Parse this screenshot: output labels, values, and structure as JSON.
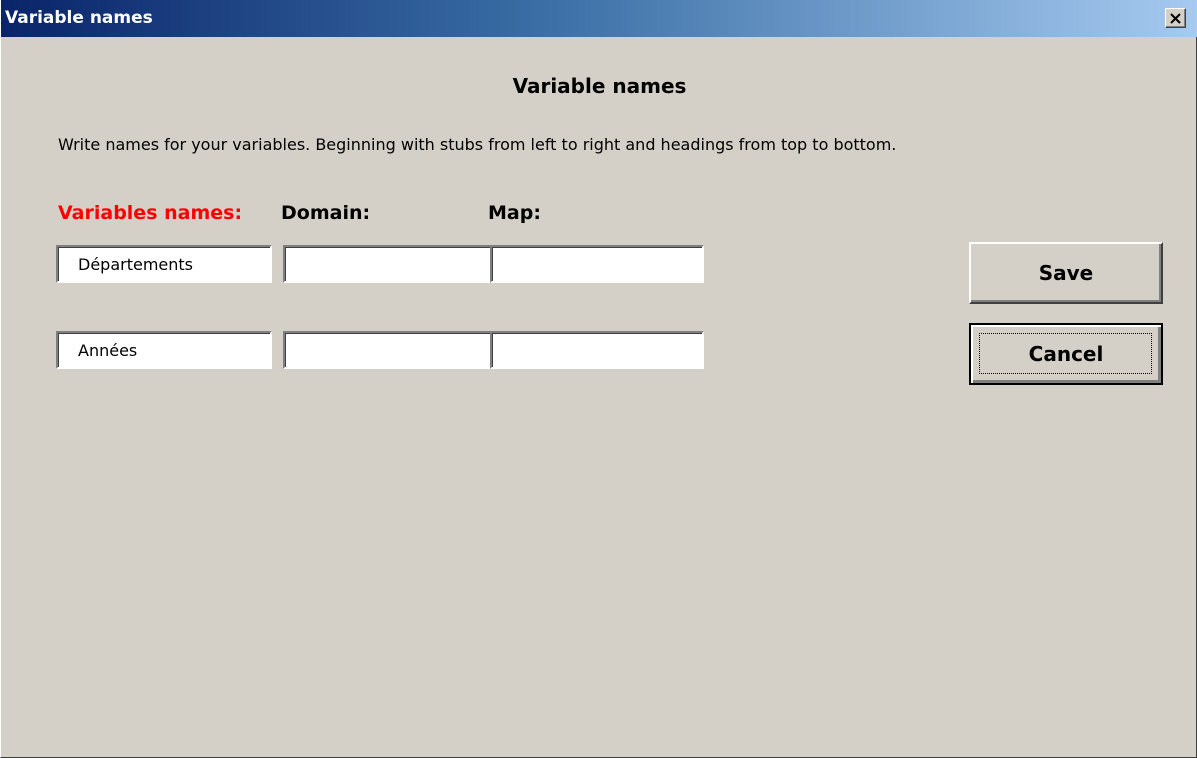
{
  "window": {
    "title": "Variable names",
    "close_icon": "close-icon"
  },
  "dialog": {
    "heading": "Variable names",
    "instructions": "Write names for your variables. Beginning with stubs from left to right and headings from top to bottom."
  },
  "columns": {
    "variables_label": "Variables names:",
    "domain_label": "Domain:",
    "map_label": "Map:"
  },
  "rows": [
    {
      "variable": "Départements",
      "domain": "",
      "map": ""
    },
    {
      "variable": "Années",
      "domain": "",
      "map": ""
    }
  ],
  "buttons": {
    "save_label": "Save",
    "cancel_label": "Cancel"
  },
  "colors": {
    "title_gradient_start": "#0a246a",
    "title_gradient_end": "#a6caf0",
    "variables_label_color": "#ff0000",
    "dialog_background": "#d4d0c8"
  }
}
